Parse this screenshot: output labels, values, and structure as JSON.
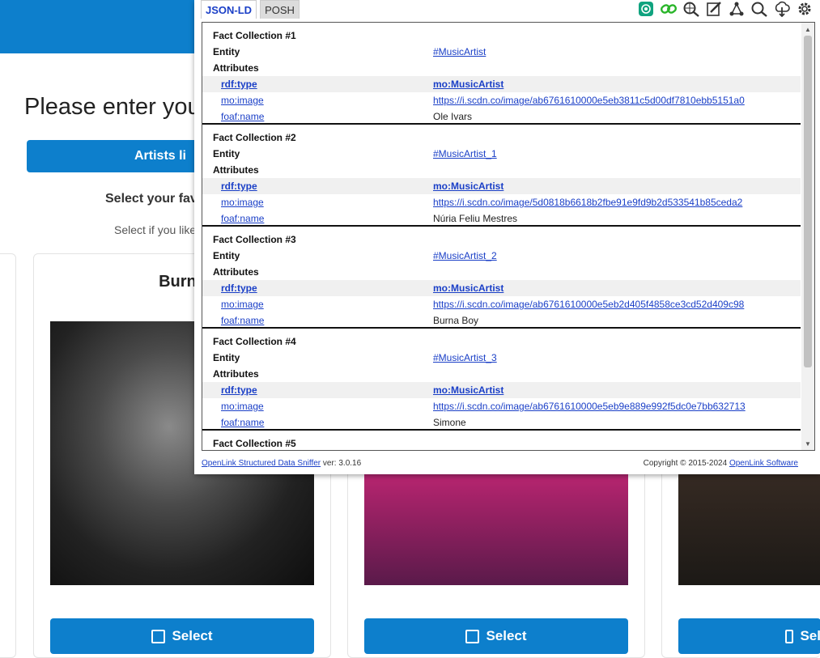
{
  "page": {
    "heading": "Please enter you",
    "artists_button": "Artists li",
    "subheading": "Select your favo",
    "subtext": "Select if you like"
  },
  "cards": [
    {
      "title": "Burna",
      "select_label": "Select"
    },
    {
      "select_label": "Select"
    },
    {
      "select_label": "Sel"
    }
  ],
  "sniffer": {
    "tabs": [
      {
        "label": "JSON-LD",
        "active": true
      },
      {
        "label": "POSH",
        "active": false
      }
    ],
    "toolbar_icons": [
      "chatgpt-icon",
      "link-icon",
      "search-globe-icon",
      "edit-icon",
      "graph-icon",
      "search-icon",
      "upload-icon",
      "settings-icon"
    ],
    "collections": [
      {
        "title": "Fact Collection #1",
        "entity_label": "Entity",
        "entity": "#MusicArtist",
        "attributes_label": "Attributes",
        "attributes": [
          {
            "key": "rdf:type",
            "value": "mo:MusicArtist"
          },
          {
            "key": "mo:image",
            "value": "https://i.scdn.co/image/ab6761610000e5eb3811c5d00df7810ebb5151a0"
          },
          {
            "key": "foaf:name",
            "value": "Ole Ivars"
          }
        ]
      },
      {
        "title": "Fact Collection #2",
        "entity_label": "Entity",
        "entity": "#MusicArtist_1",
        "attributes_label": "Attributes",
        "attributes": [
          {
            "key": "rdf:type",
            "value": "mo:MusicArtist"
          },
          {
            "key": "mo:image",
            "value": "https://i.scdn.co/image/5d0818b6618b2fbe91e9fd9b2d533541b85ceda2"
          },
          {
            "key": "foaf:name",
            "value": "Núria Feliu Mestres"
          }
        ]
      },
      {
        "title": "Fact Collection #3",
        "entity_label": "Entity",
        "entity": "#MusicArtist_2",
        "attributes_label": "Attributes",
        "attributes": [
          {
            "key": "rdf:type",
            "value": "mo:MusicArtist"
          },
          {
            "key": "mo:image",
            "value": "https://i.scdn.co/image/ab6761610000e5eb2d405f4858ce3cd52d409c98"
          },
          {
            "key": "foaf:name",
            "value": "Burna Boy"
          }
        ]
      },
      {
        "title": "Fact Collection #4",
        "entity_label": "Entity",
        "entity": "#MusicArtist_3",
        "attributes_label": "Attributes",
        "attributes": [
          {
            "key": "rdf:type",
            "value": "mo:MusicArtist"
          },
          {
            "key": "mo:image",
            "value": "https://i.scdn.co/image/ab6761610000e5eb9e889e992f5dc0e7bb632713"
          },
          {
            "key": "foaf:name",
            "value": "Simone"
          }
        ]
      },
      {
        "title": "Fact Collection #5"
      }
    ],
    "footer": {
      "link": "OpenLink Structured Data Sniffer",
      "version": " ver: 3.0.16",
      "copyright": "Copyright © 2015-2024 ",
      "company_link": "OpenLink Software"
    }
  },
  "colors": {
    "brand_blue": "#0d7fcc",
    "link_blue": "#1a3fc7"
  }
}
